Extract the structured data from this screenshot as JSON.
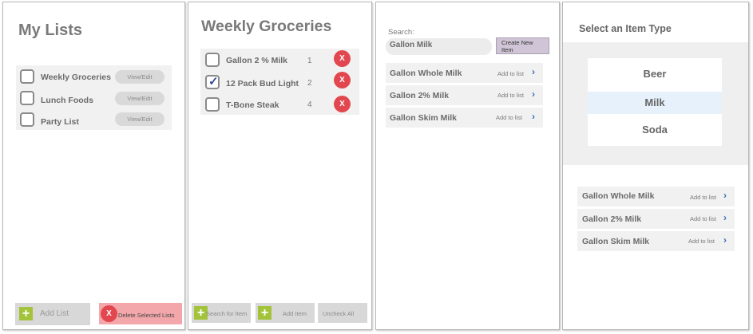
{
  "my_lists": {
    "title": "My Lists",
    "lists": [
      {
        "label": "Weekly Groceries",
        "action": "View/Edit"
      },
      {
        "label": "Lunch Foods",
        "action": "View/Edit"
      },
      {
        "label": "Party List",
        "action": "View/Edit"
      }
    ],
    "add_list_label": "Add List",
    "delete_label": "Delete Selected Lists",
    "delete_icon": "X"
  },
  "weekly_groceries": {
    "title": "Weekly Groceries",
    "items": [
      {
        "label": "Gallon 2 % Milk",
        "qty": "1",
        "checked": false
      },
      {
        "label": "12 Pack Bud Light",
        "qty": "2",
        "checked": true
      },
      {
        "label": "T-Bone Steak",
        "qty": "4",
        "checked": false
      }
    ],
    "remove_icon": "X",
    "check_mark": "✓",
    "search_label": "Search for Item",
    "add_item_label": "Add Item",
    "uncheck_all_label": "Uncheck All"
  },
  "search": {
    "label": "Search:",
    "value": "Gallon Milk",
    "create_new_label": "Create New Item",
    "results": [
      {
        "label": "Gallon Whole Milk",
        "action": "Add to list"
      },
      {
        "label": "Gallon 2% Milk",
        "action": "Add to list"
      },
      {
        "label": "Gallon Skim Milk",
        "action": "Add to list"
      }
    ]
  },
  "item_type": {
    "title": "Select an Item Type",
    "options": [
      "Beer",
      "Milk",
      "Soda"
    ],
    "selected": "Milk",
    "results": [
      {
        "label": "Gallon Whole Milk",
        "action": "Add to list"
      },
      {
        "label": "Gallon 2% Milk",
        "action": "Add to list"
      },
      {
        "label": "Gallon Skim Milk",
        "action": "Add to list"
      }
    ]
  },
  "colors": {
    "accent_green": "#a3c43a",
    "danger_red": "#e2474f",
    "chevron_blue": "#3a6fb8",
    "selected_row": "#e6f1fb"
  },
  "icons": {
    "plus": "+",
    "chevron": "›"
  }
}
